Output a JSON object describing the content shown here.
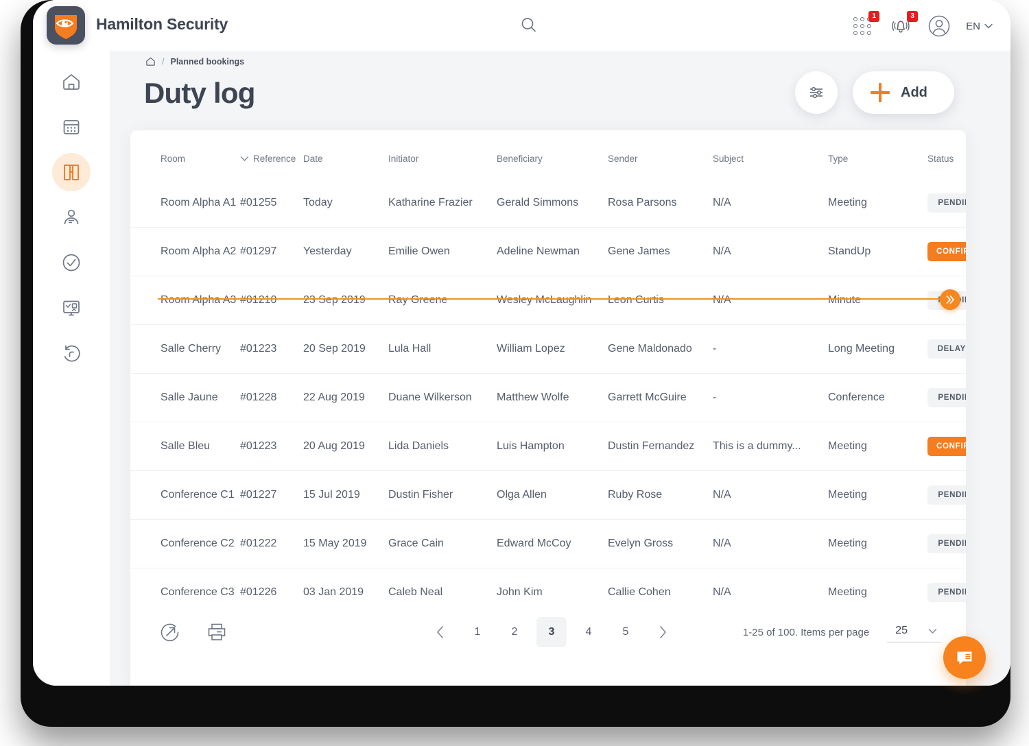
{
  "header": {
    "brand_title": "Hamilton Security",
    "logo_icon": "shield-eye-logo",
    "search_icon": "search-icon",
    "apps_icon": "apps-grid-icon",
    "apps_badge": "1",
    "notifications_icon": "bell-icon",
    "notifications_badge": "3",
    "account_icon": "user-avatar-icon",
    "language": "EN",
    "language_chevron": "chevron-down-icon"
  },
  "sidebar": {
    "items": [
      {
        "name": "home",
        "icon": "home-icon",
        "active": false
      },
      {
        "name": "calendar",
        "icon": "calendar-icon",
        "active": false
      },
      {
        "name": "bookings",
        "icon": "book-icon",
        "active": true
      },
      {
        "name": "contacts",
        "icon": "person-card-icon",
        "active": false
      },
      {
        "name": "tasks",
        "icon": "check-circle-icon",
        "active": false
      },
      {
        "name": "dashboard",
        "icon": "monitor-chart-icon",
        "active": false
      },
      {
        "name": "history",
        "icon": "history-rotate-icon",
        "active": false
      }
    ]
  },
  "breadcrumb": {
    "home_icon": "home-icon",
    "separator": "/",
    "current": "Planned bookings"
  },
  "page": {
    "title": "Duty log",
    "filter_icon": "sliders-filter-icon",
    "add_label": "Add",
    "add_icon": "plus-icon"
  },
  "table": {
    "sort_icon": "chevron-down-icon",
    "sorted_column": "Reference",
    "scroll_icon": "double-chevron-right-icon",
    "columns": [
      "Room",
      "Reference",
      "Date",
      "Initiator",
      "Beneficiary",
      "Sender",
      "Subject",
      "Type",
      "Status"
    ],
    "rows": [
      {
        "room": "Room Alpha A1",
        "reference": "#01255",
        "date": "Today",
        "initiator": "Katharine Frazier",
        "beneficiary": "Gerald Simmons",
        "sender": "Rosa Parsons",
        "subject": "N/A",
        "type": "Meeting",
        "status": "PENDING",
        "status_kind": "pending"
      },
      {
        "room": "Room Alpha A2",
        "reference": "#01297",
        "date": "Yesterday",
        "initiator": "Emilie Owen",
        "beneficiary": "Adeline Newman",
        "sender": "Gene James",
        "subject": "N/A",
        "type": "StandUp",
        "status": "CONFIRMED",
        "status_kind": "confirmed"
      },
      {
        "room": "Room Alpha A3",
        "reference": "#01210",
        "date": "23 Sep 2019",
        "initiator": "Ray Greene",
        "beneficiary": "Wesley McLaughlin",
        "sender": "Leon Curtis",
        "subject": "N/A",
        "type": "Minute",
        "status": "PENDING",
        "status_kind": "pending"
      },
      {
        "room": "Salle Cherry",
        "reference": "#01223",
        "date": "20 Sep 2019",
        "initiator": "Lula Hall",
        "beneficiary": "William Lopez",
        "sender": "Gene Maldonado",
        "subject": "-",
        "type": "Long Meeting",
        "status": "DELAYED",
        "status_kind": "delayed"
      },
      {
        "room": "Salle Jaune",
        "reference": "#01228",
        "date": "22 Aug 2019",
        "initiator": "Duane Wilkerson",
        "beneficiary": "Matthew Wolfe",
        "sender": "Garrett McGuire",
        "subject": "-",
        "type": "Conference",
        "status": "PENDING",
        "status_kind": "pending"
      },
      {
        "room": "Salle Bleu",
        "reference": "#01223",
        "date": "20 Aug 2019",
        "initiator": "Lida Daniels",
        "beneficiary": "Luis Hampton",
        "sender": "Dustin Fernandez",
        "subject": "This is a dummy...",
        "type": "Meeting",
        "status": "CONFIRMEND",
        "status_kind": "confirmed"
      },
      {
        "room": "Conference C1",
        "reference": "#01227",
        "date": "15 Jul 2019",
        "initiator": "Dustin Fisher",
        "beneficiary": "Olga Allen",
        "sender": "Ruby Rose",
        "subject": "N/A",
        "type": "Meeting",
        "status": "PENDING",
        "status_kind": "pending"
      },
      {
        "room": "Conference C2",
        "reference": "#01222",
        "date": "15 May 2019",
        "initiator": "Grace Cain",
        "beneficiary": "Edward McCoy",
        "sender": "Evelyn Gross",
        "subject": "N/A",
        "type": "Meeting",
        "status": "PENDING",
        "status_kind": "pending"
      },
      {
        "room": "Conference C3",
        "reference": "#01226",
        "date": "03 Jan 2019",
        "initiator": "Caleb Neal",
        "beneficiary": "John Kim",
        "sender": "Callie Cohen",
        "subject": "N/A",
        "type": "Meeting",
        "status": "PENDING",
        "status_kind": "pending"
      }
    ]
  },
  "footer": {
    "export_icon": "share-export-icon",
    "print_icon": "printer-icon",
    "prev_icon": "chevron-left-icon",
    "next_icon": "chevron-right-icon",
    "pages": [
      "1",
      "2",
      "3",
      "4",
      "5"
    ],
    "active_page": "3",
    "range_label": "1-25 of 100. Items per page",
    "per_page_value": "25",
    "per_page_chevron": "chevron-down-icon"
  },
  "fab": {
    "icon": "chat-bubble-icon"
  },
  "colors": {
    "accent": "#f57c1f",
    "accent_line": "#f0921f",
    "text_dark": "#3d4452",
    "text_body": "#555d6c",
    "text_muted": "#6f7786",
    "badge_red": "#e02020",
    "page_bg": "#f4f5f7",
    "nav_active_bg": "#fdebd7"
  }
}
